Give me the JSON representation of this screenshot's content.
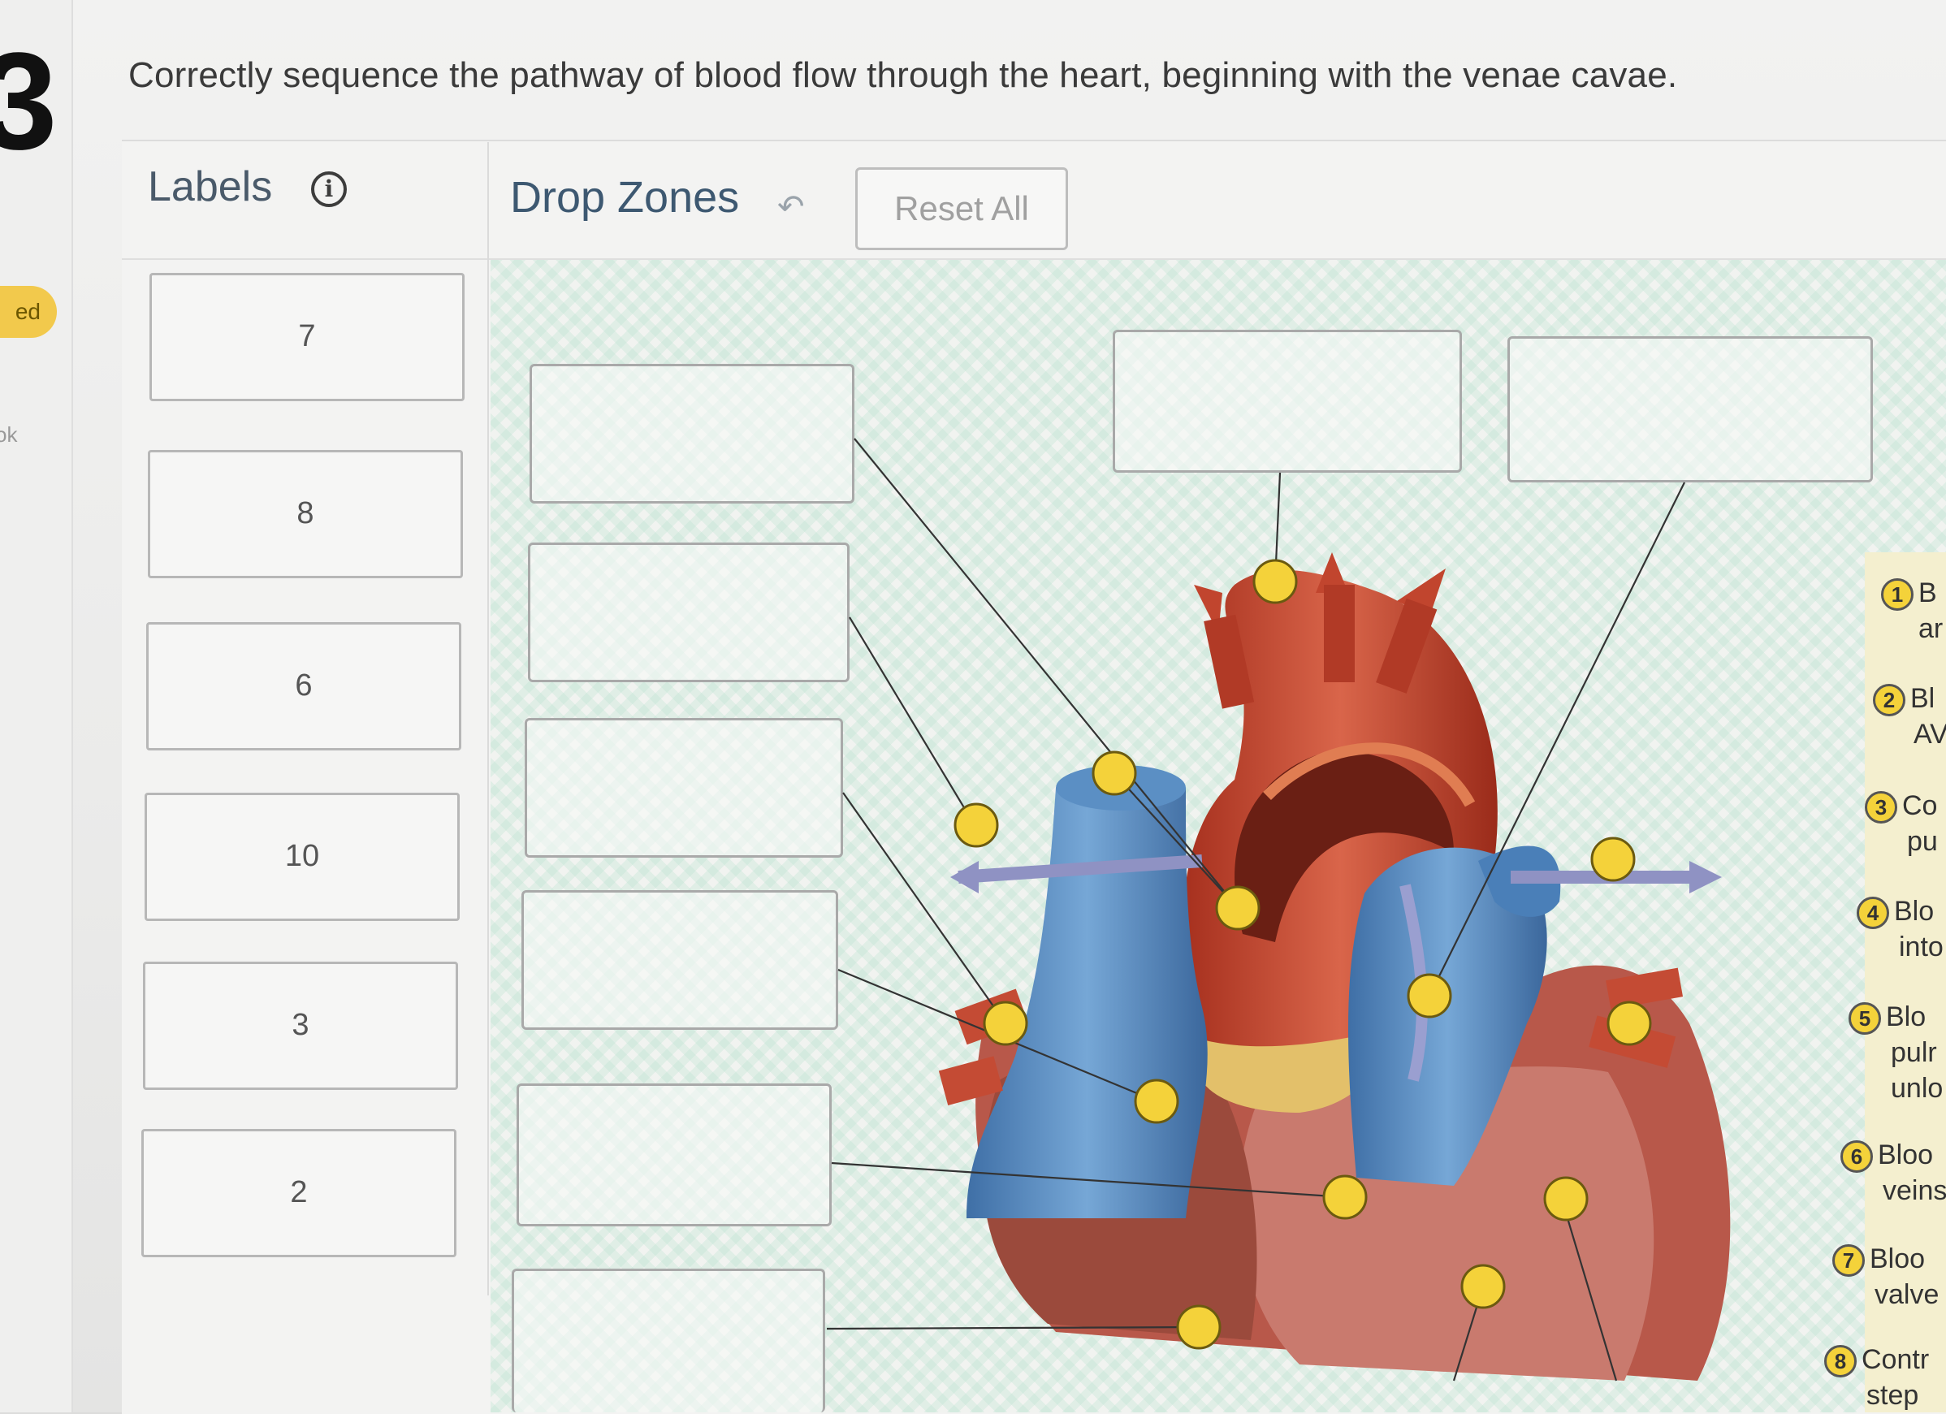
{
  "rail": {
    "question_number": "3",
    "status_pill": "ed",
    "link_fragment": "ok"
  },
  "prompt": "Correctly sequence the pathway of blood flow through the heart, beginning with the venae cavae.",
  "labels_panel": {
    "title": "Labels",
    "info_icon": "info-icon",
    "cards": [
      "7",
      "8",
      "6",
      "10",
      "3",
      "2"
    ]
  },
  "drop_panel": {
    "title": "Drop Zones",
    "undo_icon": "undo-icon",
    "reset_label": "Reset All"
  },
  "legend": [
    {
      "num": "1",
      "line1": "B",
      "line2": "ar"
    },
    {
      "num": "2",
      "line1": "Bl",
      "line2": "AV"
    },
    {
      "num": "3",
      "line1": "Co",
      "line2": "pu"
    },
    {
      "num": "4",
      "line1": "Blo",
      "line2": "into"
    },
    {
      "num": "5",
      "line1": "Blo",
      "line2": "pulr unlo"
    },
    {
      "num": "6",
      "line1": "Bloo",
      "line2": "veins"
    },
    {
      "num": "7",
      "line1": "Bloo",
      "line2": "valve"
    },
    {
      "num": "8",
      "line1": "Contr",
      "line2": "step"
    }
  ],
  "colors": {
    "accent_header": "#3d5871",
    "pin_yellow": "#f4d23a",
    "vessel_blue": "#5b8fc4",
    "vessel_red": "#c1452e",
    "drop_pattern": "#b4e1cd"
  }
}
